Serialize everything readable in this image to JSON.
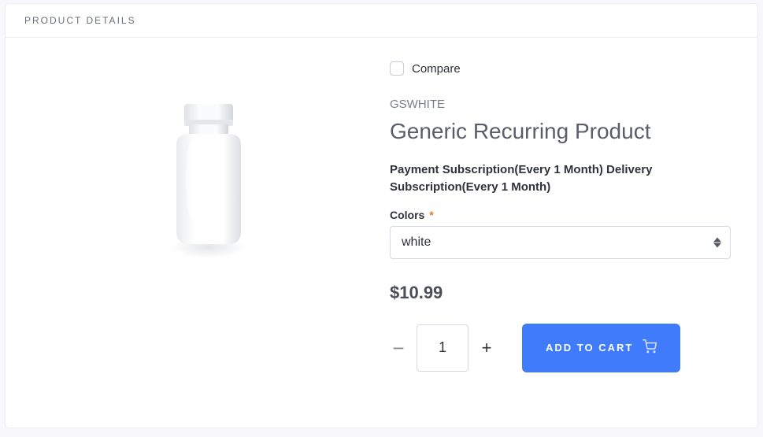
{
  "panel": {
    "title": "PRODUCT DETAILS"
  },
  "compare": {
    "label": "Compare",
    "checked": false
  },
  "product": {
    "sku": "GSWHITE",
    "title": "Generic Recurring Product",
    "subscription_text": "Payment Subscription(Every 1 Month) Delivery Subscription(Every 1 Month)",
    "price": "$10.99"
  },
  "colors": {
    "label": "Colors",
    "required_mark": "*",
    "selected": "white"
  },
  "quantity": {
    "value": "1"
  },
  "buttons": {
    "add_to_cart": "ADD TO CART"
  }
}
